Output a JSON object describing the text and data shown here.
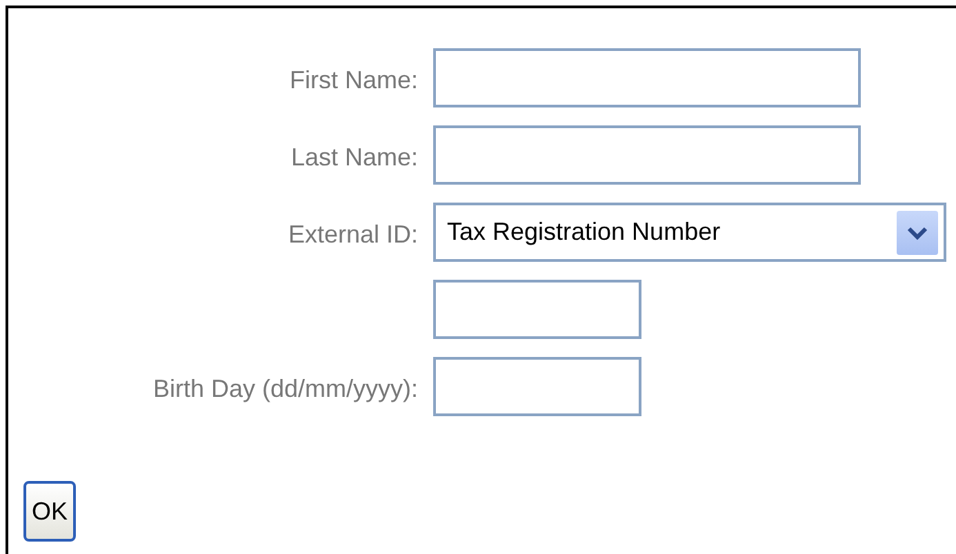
{
  "form": {
    "fields": [
      {
        "kind": "longtext",
        "label": "First Name:"
      },
      {
        "kind": "longtext",
        "label": "Last Name:"
      },
      {
        "kind": "select",
        "label": "External ID:",
        "value": "Tax Registration Number"
      },
      {
        "kind": "shorttext"
      },
      {
        "kind": "shorttext",
        "label": "Birth Day (dd/mm/yyyy):"
      }
    ],
    "buttons": [
      {
        "label": "OK"
      }
    ]
  }
}
